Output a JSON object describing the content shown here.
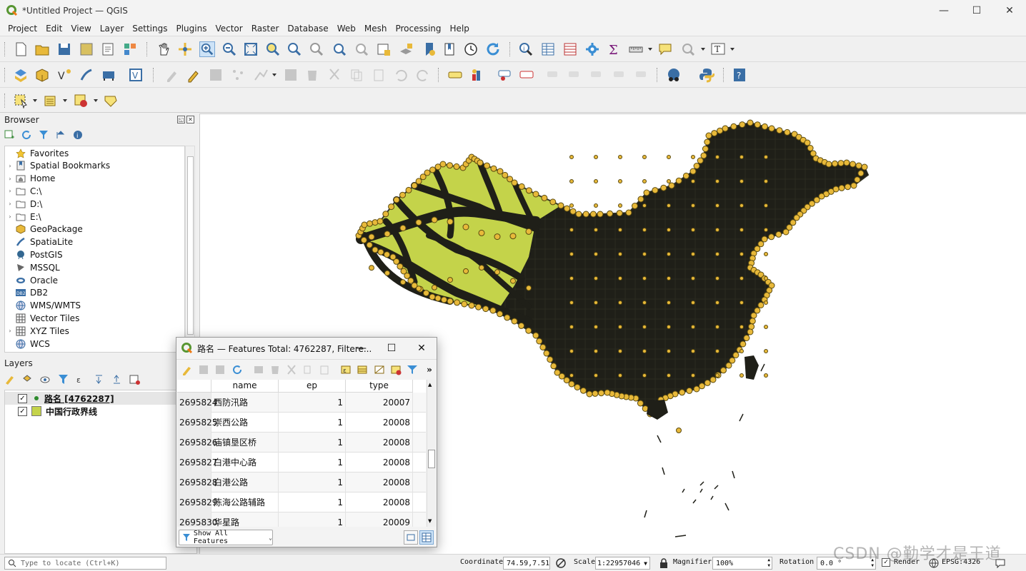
{
  "app": {
    "title": "*Untitled Project — QGIS"
  },
  "window_buttons": [
    "—",
    "☐",
    "✕"
  ],
  "menu": [
    "Project",
    "Edit",
    "View",
    "Layer",
    "Settings",
    "Plugins",
    "Vector",
    "Raster",
    "Database",
    "Web",
    "Mesh",
    "Processing",
    "Help"
  ],
  "browser": {
    "title": "Browser",
    "items": [
      {
        "label": "Favorites",
        "icon": "star-icon",
        "expandable": false
      },
      {
        "label": "Spatial Bookmarks",
        "icon": "bookmark-icon",
        "expandable": true
      },
      {
        "label": "Home",
        "icon": "home-folder-icon",
        "expandable": true
      },
      {
        "label": "C:\\",
        "icon": "folder-icon",
        "expandable": true
      },
      {
        "label": "D:\\",
        "icon": "folder-icon",
        "expandable": true
      },
      {
        "label": "E:\\",
        "icon": "folder-icon",
        "expandable": true
      },
      {
        "label": "GeoPackage",
        "icon": "geopackage-icon",
        "expandable": false
      },
      {
        "label": "SpatiaLite",
        "icon": "spatialite-icon",
        "expandable": false
      },
      {
        "label": "PostGIS",
        "icon": "postgis-icon",
        "expandable": false
      },
      {
        "label": "MSSQL",
        "icon": "mssql-icon",
        "expandable": false
      },
      {
        "label": "Oracle",
        "icon": "oracle-icon",
        "expandable": false
      },
      {
        "label": "DB2",
        "icon": "db2-icon",
        "expandable": false
      },
      {
        "label": "WMS/WMTS",
        "icon": "globe-icon",
        "expandable": false
      },
      {
        "label": "Vector Tiles",
        "icon": "grid-icon",
        "expandable": false
      },
      {
        "label": "XYZ Tiles",
        "icon": "grid-icon",
        "expandable": true
      },
      {
        "label": "WCS",
        "icon": "globe-icon",
        "expandable": false
      }
    ]
  },
  "layers": {
    "title": "Layers",
    "items": [
      {
        "label": "路名 [4762287]",
        "checked": true,
        "symbol": "point",
        "color": "#2e8b2e",
        "underline": true
      },
      {
        "label": "中国行政界线",
        "checked": true,
        "symbol": "fill",
        "color": "#c4d34a",
        "underline": false
      }
    ]
  },
  "attribute_table": {
    "title": "路名 — Features Total: 4762287, Filtere...",
    "columns": [
      "name",
      "ep",
      "type"
    ],
    "rows": [
      {
        "id": "2695824",
        "name": "西防汛路",
        "ep": "1",
        "type": "20007"
      },
      {
        "id": "2695825",
        "name": "崇西公路",
        "ep": "1",
        "type": "20008"
      },
      {
        "id": "2695826",
        "name": "庙镇垦区桥",
        "ep": "1",
        "type": "20008"
      },
      {
        "id": "2695827",
        "name": "白港中心路",
        "ep": "1",
        "type": "20008"
      },
      {
        "id": "2695828",
        "name": "白港公路",
        "ep": "1",
        "type": "20008"
      },
      {
        "id": "2695829",
        "name": "陈海公路辅路",
        "ep": "1",
        "type": "20008"
      },
      {
        "id": "2695830",
        "name": "华星路",
        "ep": "1",
        "type": "20009"
      }
    ],
    "show_all": "Show All Features"
  },
  "statusbar": {
    "locate_placeholder": "Type to locate (Ctrl+K)",
    "coordinate_label": "Coordinate",
    "coordinate_value": "74.59,7.51",
    "scale_label": "Scale",
    "scale_value": "1:22957046",
    "magnifier_label": "Magnifier",
    "magnifier_value": "100%",
    "rotation_label": "Rotation",
    "rotation_value": "0.0 °",
    "render_label": "Render",
    "crs_label": "EPSG:4326"
  },
  "watermark": "CSDN @勤学才是王道",
  "colors": {
    "fill": "#c4d34a",
    "roads": "#1f1f18",
    "points": "#e8b93a"
  }
}
